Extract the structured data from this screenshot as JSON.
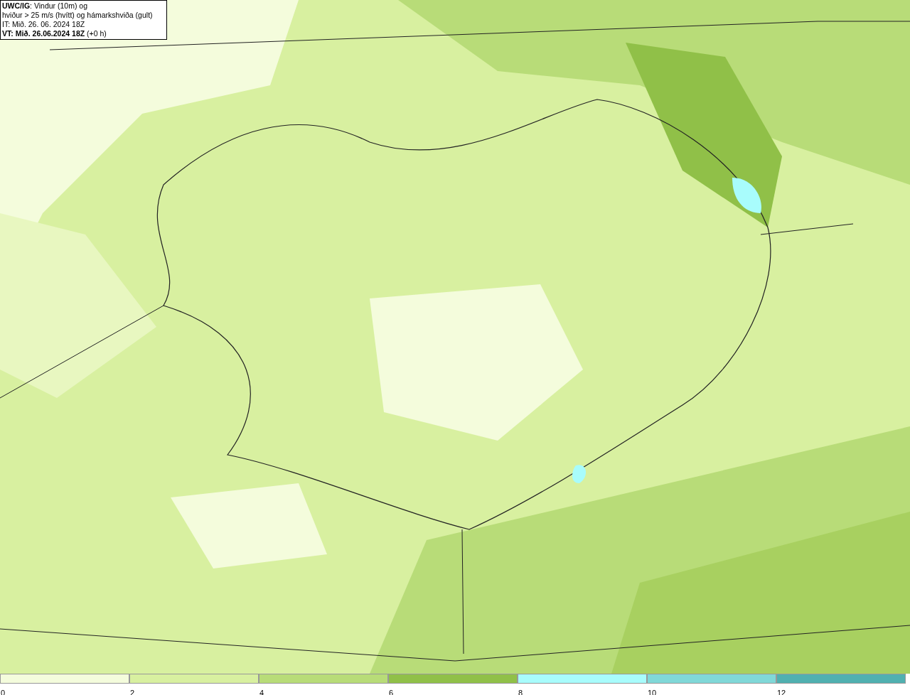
{
  "title_box": {
    "lines": [
      "**UWC/IG**: Vindur (10m) og",
      "hviður > 25 m/s (hvítt) og hámarkshviða (gult)",
      "IT: Mið. 26. 06. 2024 18Z",
      "**VT: Mið. 26.06.2024 18Z** (+0 h)"
    ]
  },
  "legend": [
    {
      "label": "0",
      "color": "#f4fcdc"
    },
    {
      "label": "2",
      "color": "#d8f0a0"
    },
    {
      "label": "4",
      "color": "#b8dc78"
    },
    {
      "label": "6",
      "color": "#90c048"
    },
    {
      "label": "8",
      "color": "#a8fcfc"
    },
    {
      "label": "10",
      "color": "#80d8d8"
    },
    {
      "label": "12",
      "color": "#50b0b0"
    }
  ]
}
